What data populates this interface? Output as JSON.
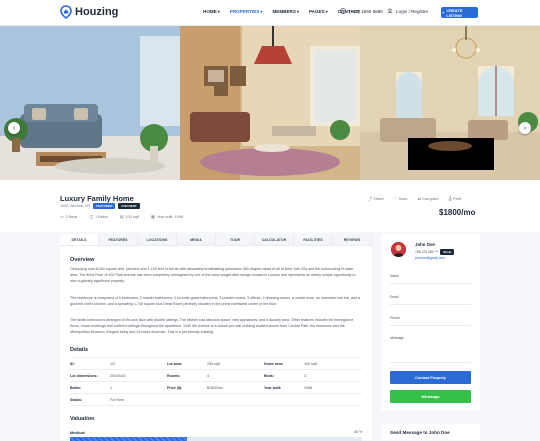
{
  "header": {
    "logo_text": "Houzing",
    "nav": [
      "HOME",
      "PROPERTIES",
      "MEMBERS",
      "PAGES",
      "CONTACT"
    ],
    "active_nav": "PROPERTIES",
    "phone": "(+88) 1990 6886",
    "login": "Login / Register",
    "create_listing": "CREATE LISTING"
  },
  "colors": {
    "accent": "#2a6bd8",
    "whatsapp": "#33c14a",
    "dark": "#1d2a3a"
  },
  "gallery": {
    "prev_icon": "chevron-left-icon",
    "next_icon": "chevron-right-icon"
  },
  "property": {
    "title": "Luxury Family Home",
    "address": "1092 Vail Ave, NY",
    "badge_featured": "FEATURED",
    "badge_status": "FOR RENT",
    "beds": "3 Beds",
    "baths": "1 Baths",
    "area": "100 sqft",
    "year": "Year built: 1998",
    "price": "$1800/mo",
    "actions": [
      "Share",
      "Save",
      "Compare",
      "Print"
    ]
  },
  "tabs": [
    "DETAILS",
    "FEATURES",
    "LOCATIONS",
    "MEDIA",
    "TOUR",
    "CALCULATOR",
    "FACILITIES",
    "REVIEWS"
  ],
  "overview": {
    "title": "Overview",
    "p1": "Occupying over 8,000 square feet, perched over 1,100 feet in the air with absolutely breathtaking panoramic 360-degree views of all of New York City and the surrounding tri-state area. The 82nd Floor of 432 Park Avenue has been completely reimagined by one of the most sought-after design houses in London and represents an utterly unique opportunity to own a globally significant property.",
    "p2": "The residence is comprised of 5 bedrooms, 2 master bathrooms, 4 en-suite guest bathrooms, 2 powder rooms, 3 offices, 2 dressing rooms, a media room, an oversized wet bar, and a gourmet chef's kitchen, and a sprawling 1,740 square foot Great Room perfectly situated in the prime northwest corner of the floor.",
    "p3": "The lavish bedroom is arranged on its own floor with double ceilings. The kitchen has fabulous space, new appliances, and a laundry area. Other features include rich herringbone floors, crown moldings and coffered ceilings throughout the apartment. 1049 5th Avenue is a classic pre-war building located across from Central Park, the museums and the Metropolitan Museum. Elegant lobby and 24 hours doorman. This is a pet-friendly building."
  },
  "details": {
    "title": "Details",
    "rows": [
      [
        [
          "ID:",
          "1/2"
        ],
        [
          "Lot area:",
          "250 sqft"
        ],
        [
          "Home area:",
          "100 sqft"
        ]
      ],
      [
        [
          "Lot dimensions:",
          "20x20x20"
        ],
        [
          "Rooms:",
          "4"
        ],
        [
          "Beds:",
          "3"
        ]
      ],
      [
        [
          "Baths:",
          "1"
        ],
        [
          "Price ($):",
          "$1800/mo"
        ],
        [
          "Year built:",
          "1998"
        ]
      ],
      [
        [
          "Status:",
          "For Rent"
        ],
        [
          "",
          ""
        ],
        [
          "",
          ""
        ]
      ]
    ]
  },
  "valuation": {
    "title": "Valuation",
    "label": "Medical",
    "percent_text": "40 %",
    "percent": 0.4
  },
  "agent": {
    "name": "John Doe",
    "phone": "+88 123 456 ***",
    "phone_badge": "Show",
    "email": "johndoe@gmail.com",
    "fields": [
      "Name",
      "Email",
      "Phone",
      "Message"
    ],
    "contact_button": "Contact Property",
    "whatsapp_button": "Whatsapp"
  },
  "send_message": {
    "title": "Send Message to John Doe"
  }
}
